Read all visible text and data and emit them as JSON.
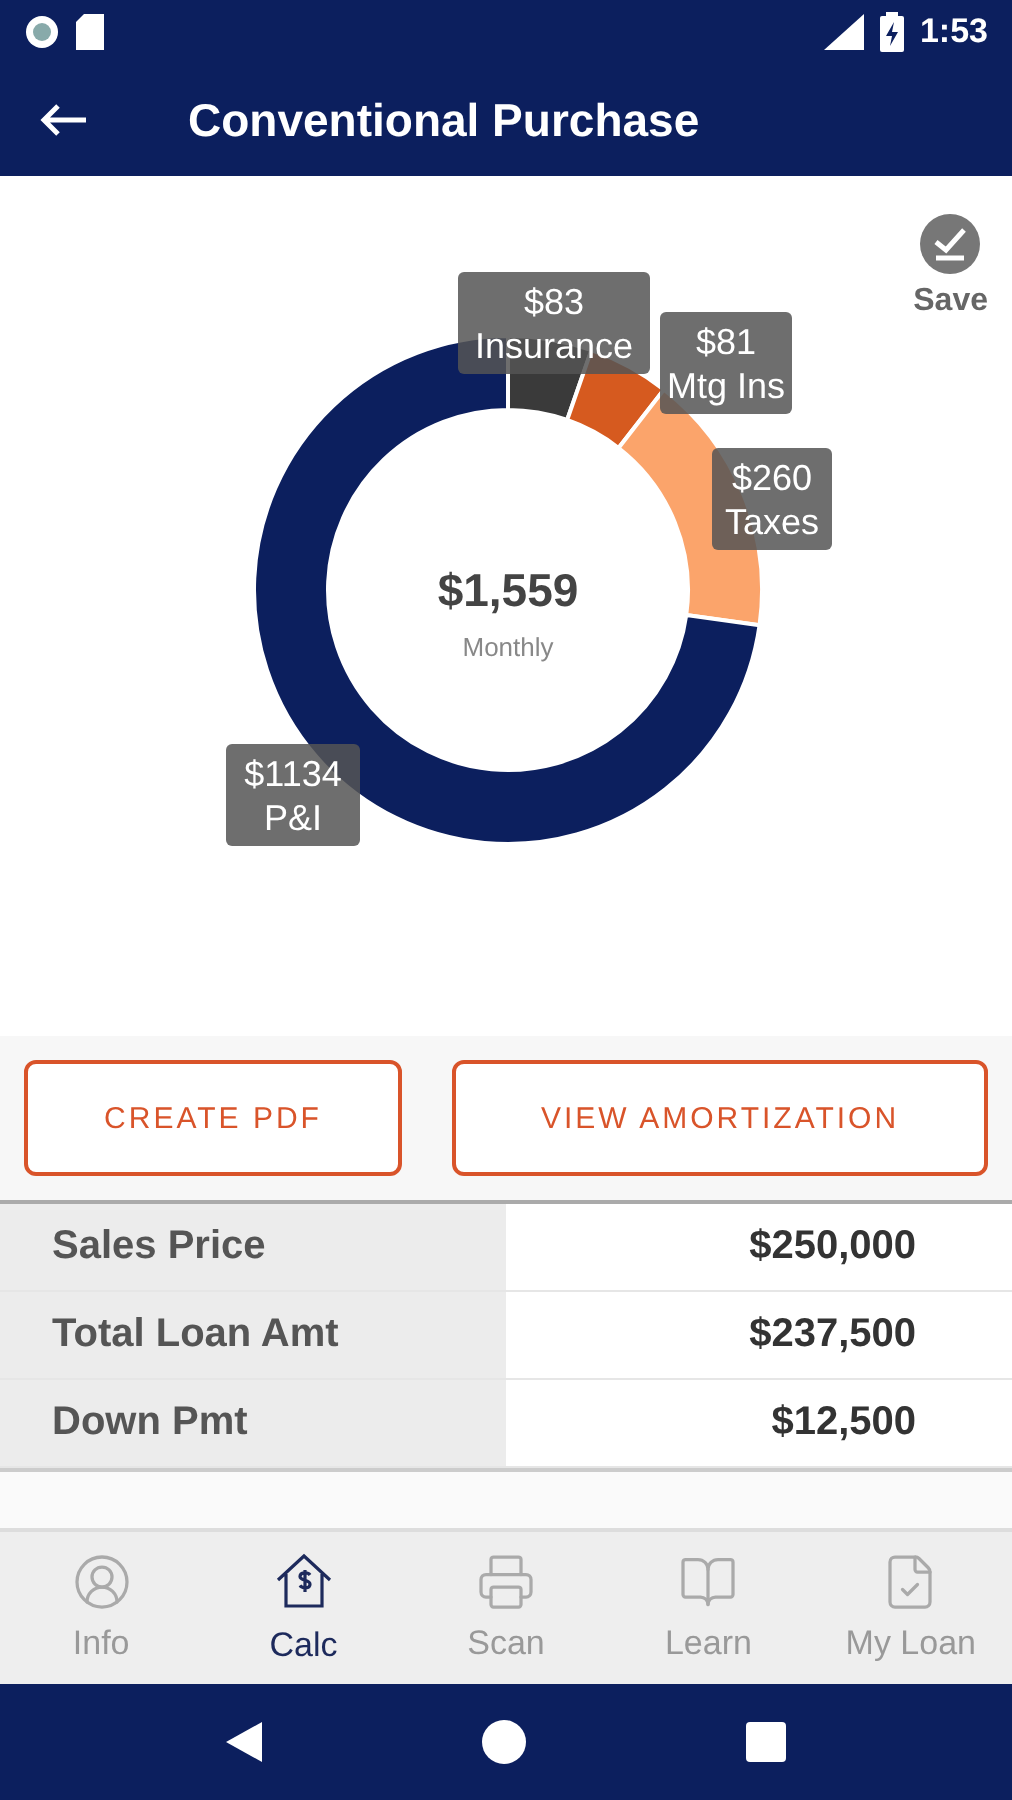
{
  "status_bar": {
    "time": "1:53"
  },
  "app_bar": {
    "title": "Conventional Purchase"
  },
  "chart": {
    "save_label": "Save",
    "total": "$1,559",
    "total_caption": "Monthly",
    "chart_data": {
      "type": "donut",
      "categories": [
        "Insurance",
        "Mtg Ins",
        "Taxes",
        "P&I"
      ],
      "values": [
        83,
        81,
        260,
        1134
      ],
      "value_labels": [
        "$83",
        "$81",
        "$260",
        "$1134"
      ]
    }
  },
  "buttons": [
    "CREATE PDF",
    "VIEW AMORTIZATION"
  ],
  "summary": [
    {
      "label": "Sales Price",
      "value": "$250,000"
    },
    {
      "label": "Total Loan Amt",
      "value": "$237,500"
    },
    {
      "label": "Down Pmt",
      "value": "$12,500"
    }
  ],
  "bottom_nav": [
    {
      "label": "Info",
      "kind": "info",
      "selected": false
    },
    {
      "label": "Calc",
      "kind": "calc",
      "selected": true
    },
    {
      "label": "Scan",
      "kind": "scan",
      "selected": false
    },
    {
      "label": "Learn",
      "kind": "learn",
      "selected": false
    },
    {
      "label": "My Loan",
      "kind": "loan",
      "selected": false
    }
  ]
}
